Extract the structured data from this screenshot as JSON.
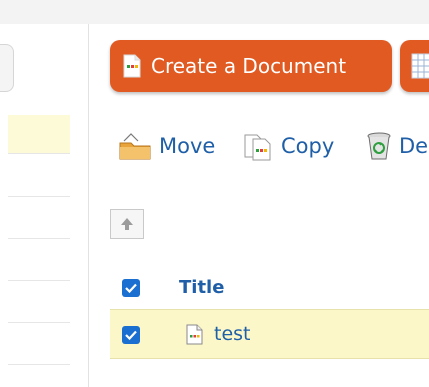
{
  "toolbar": {
    "create_document_label": "Create a Document",
    "move_label": "Move",
    "copy_label": "Copy",
    "delete_label": "De"
  },
  "table": {
    "header": {
      "title_label": "Title",
      "select_all_checked": true
    },
    "rows": [
      {
        "name": "test",
        "checked": true,
        "icon": "document-icon"
      }
    ]
  },
  "colors": {
    "accent": "#e05a22",
    "link": "#1f5fa8",
    "checkbox": "#1a6fd0",
    "selected_row": "#fbf7c9"
  }
}
